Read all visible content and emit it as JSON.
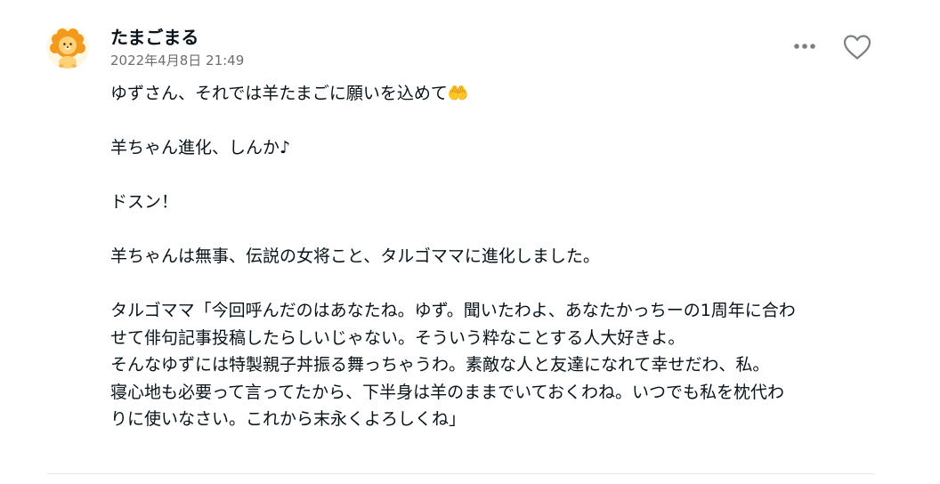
{
  "comment": {
    "author": "たまごまる",
    "date": "2022年4月8日 21:49",
    "avatar_icon": "lion-avatar",
    "more_icon": "more-horizontal-icon",
    "like_icon": "heart-outline-icon",
    "paragraphs": [
      "ゆずさん、それでは羊たまごに願いを込めて🤲",
      "羊ちゃん進化、しんか♪",
      "ドスン！",
      "羊ちゃんは無事、伝説の女将こと、タルゴママに進化しました。",
      "タルゴママ「今回呼んだのはあなたね。ゆず。聞いたわよ、あなたかっちーの1周年に合わ\nせて俳句記事投稿したらしいじゃない。そういう粋なことする人大好きよ。\nそんなゆずには特製親子丼振る舞っちゃうわ。素敵な人と友達になれて幸せだわ、私。\n寝心地も必要って言ってたから、下半身は羊のままでいておくわね。いつでも私を枕代わ\nりに使いなさい。これから末永くよろしくね」"
    ]
  },
  "colors": {
    "text": "#08131a",
    "date": "#6b6f73",
    "icon": "#7b7f83",
    "avatar_main": "#f7a82c",
    "divider": "#e5e7e9"
  }
}
